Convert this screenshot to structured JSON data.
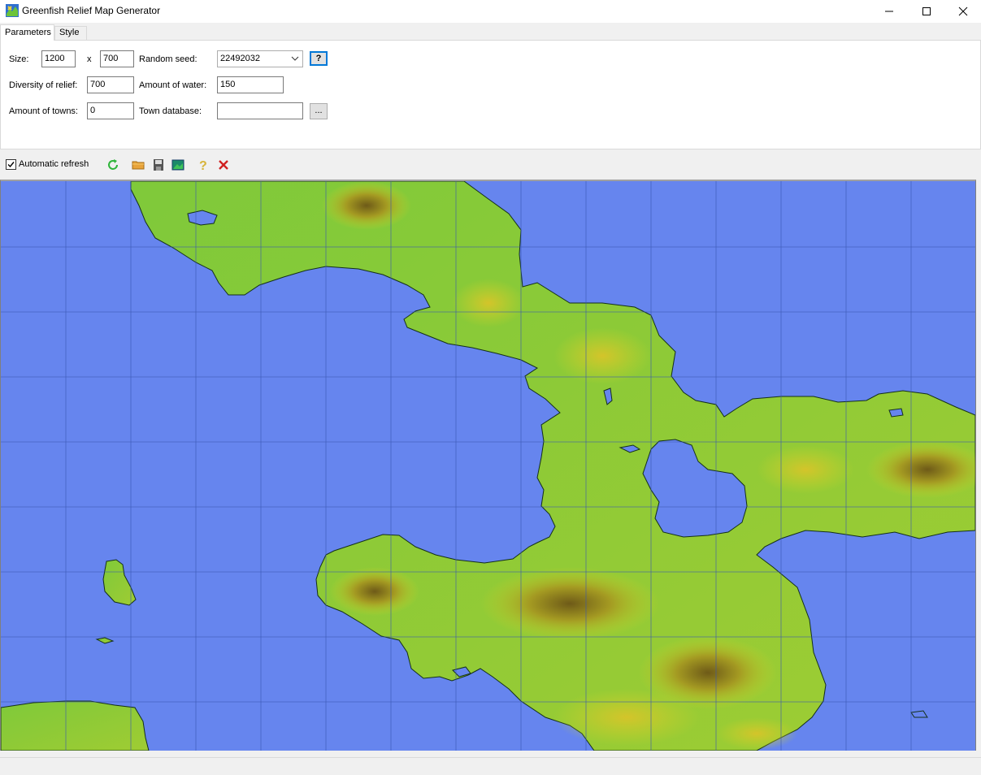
{
  "window": {
    "title": "Greenfish Relief Map Generator",
    "icon": "greenfish-app-icon",
    "controls": [
      "minimize-icon",
      "maximize-icon",
      "close-icon"
    ]
  },
  "tabs": [
    {
      "label": "Parameters",
      "active": true
    },
    {
      "label": "Style",
      "active": false
    }
  ],
  "params": {
    "size_label": "Size:",
    "width": "1200",
    "x_label": "x",
    "height": "700",
    "seed_label": "Random seed:",
    "seed": "22492032",
    "help_button": "?",
    "diversity_label": "Diversity of relief:",
    "diversity": "700",
    "water_label": "Amount of water:",
    "water": "150",
    "towns_label": "Amount of towns:",
    "towns": "0",
    "town_db_label": "Town database:",
    "town_db": "",
    "browse_button": "..."
  },
  "toolbar": {
    "auto_refresh_label": "Automatic refresh",
    "auto_refresh_checked": true,
    "icons": [
      "refresh-icon",
      "open-folder-icon",
      "save-icon",
      "export-image-icon",
      "help-icon",
      "delete-icon"
    ]
  },
  "map": {
    "water_color": "#6685ee",
    "grid_color": "#3a55b0",
    "land_low_color": "#7fc93a",
    "land_mid_color": "#c8d22a",
    "land_high_color": "#6e5a18",
    "coast_color": "#14301a"
  },
  "statusbar": {
    "text": ""
  }
}
